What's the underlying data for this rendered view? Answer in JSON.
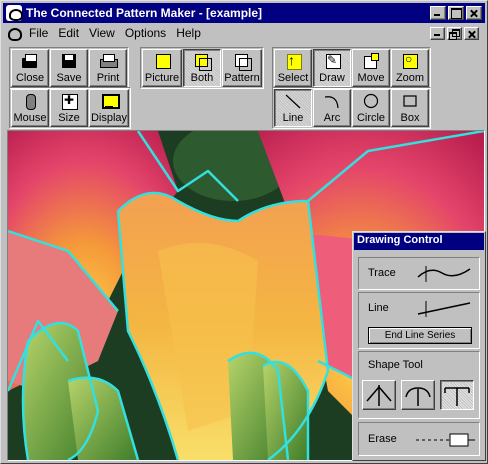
{
  "window": {
    "title": "The Connected Pattern Maker - [example]"
  },
  "menu": {
    "items": [
      {
        "label": "File"
      },
      {
        "label": "Edit"
      },
      {
        "label": "View"
      },
      {
        "label": "Options"
      },
      {
        "label": "Help"
      }
    ]
  },
  "toolbar": {
    "file_group": [
      {
        "label": "Close",
        "icon": "folder-open-icon"
      },
      {
        "label": "Save",
        "icon": "floppy-disk-icon"
      },
      {
        "label": "Print",
        "icon": "printer-icon"
      }
    ],
    "view_group": [
      {
        "label": "Picture",
        "icon": "picture-icon",
        "pressed": false
      },
      {
        "label": "Both",
        "icon": "both-icon",
        "pressed": true
      },
      {
        "label": "Pattern",
        "icon": "pattern-icon",
        "pressed": false
      }
    ],
    "mode_group": [
      {
        "label": "Select",
        "icon": "select-arrow-icon",
        "pressed": false
      },
      {
        "label": "Draw",
        "icon": "draw-pen-icon",
        "pressed": true
      },
      {
        "label": "Move",
        "icon": "move-icon",
        "pressed": false
      },
      {
        "label": "Zoom",
        "icon": "zoom-icon",
        "pressed": false
      }
    ],
    "settings_group": [
      {
        "label": "Mouse",
        "icon": "mouse-icon"
      },
      {
        "label": "Size",
        "icon": "size-icon"
      },
      {
        "label": "Display",
        "icon": "display-icon"
      }
    ],
    "shape_group": [
      {
        "label": "Line",
        "icon": "line-icon",
        "pressed": true
      },
      {
        "label": "Arc",
        "icon": "arc-icon",
        "pressed": false
      },
      {
        "label": "Circle",
        "icon": "circle-icon",
        "pressed": false
      },
      {
        "label": "Box",
        "icon": "box-icon",
        "pressed": false
      }
    ]
  },
  "drawing_control": {
    "title": "Drawing Control",
    "trace_label": "Trace",
    "line_label": "Line",
    "end_line_series_label": "End Line Series",
    "shape_tool_label": "Shape Tool",
    "shape_tools": [
      {
        "icon": "arrow-up-shape-icon",
        "active": false
      },
      {
        "icon": "t-shape-icon",
        "active": false
      },
      {
        "icon": "t-bar-shape-icon",
        "active": true
      }
    ],
    "erase_label": "Erase"
  },
  "colors": {
    "title_bar": "#000080",
    "face": "#c0c0c0",
    "outline": "#33e0e0"
  }
}
